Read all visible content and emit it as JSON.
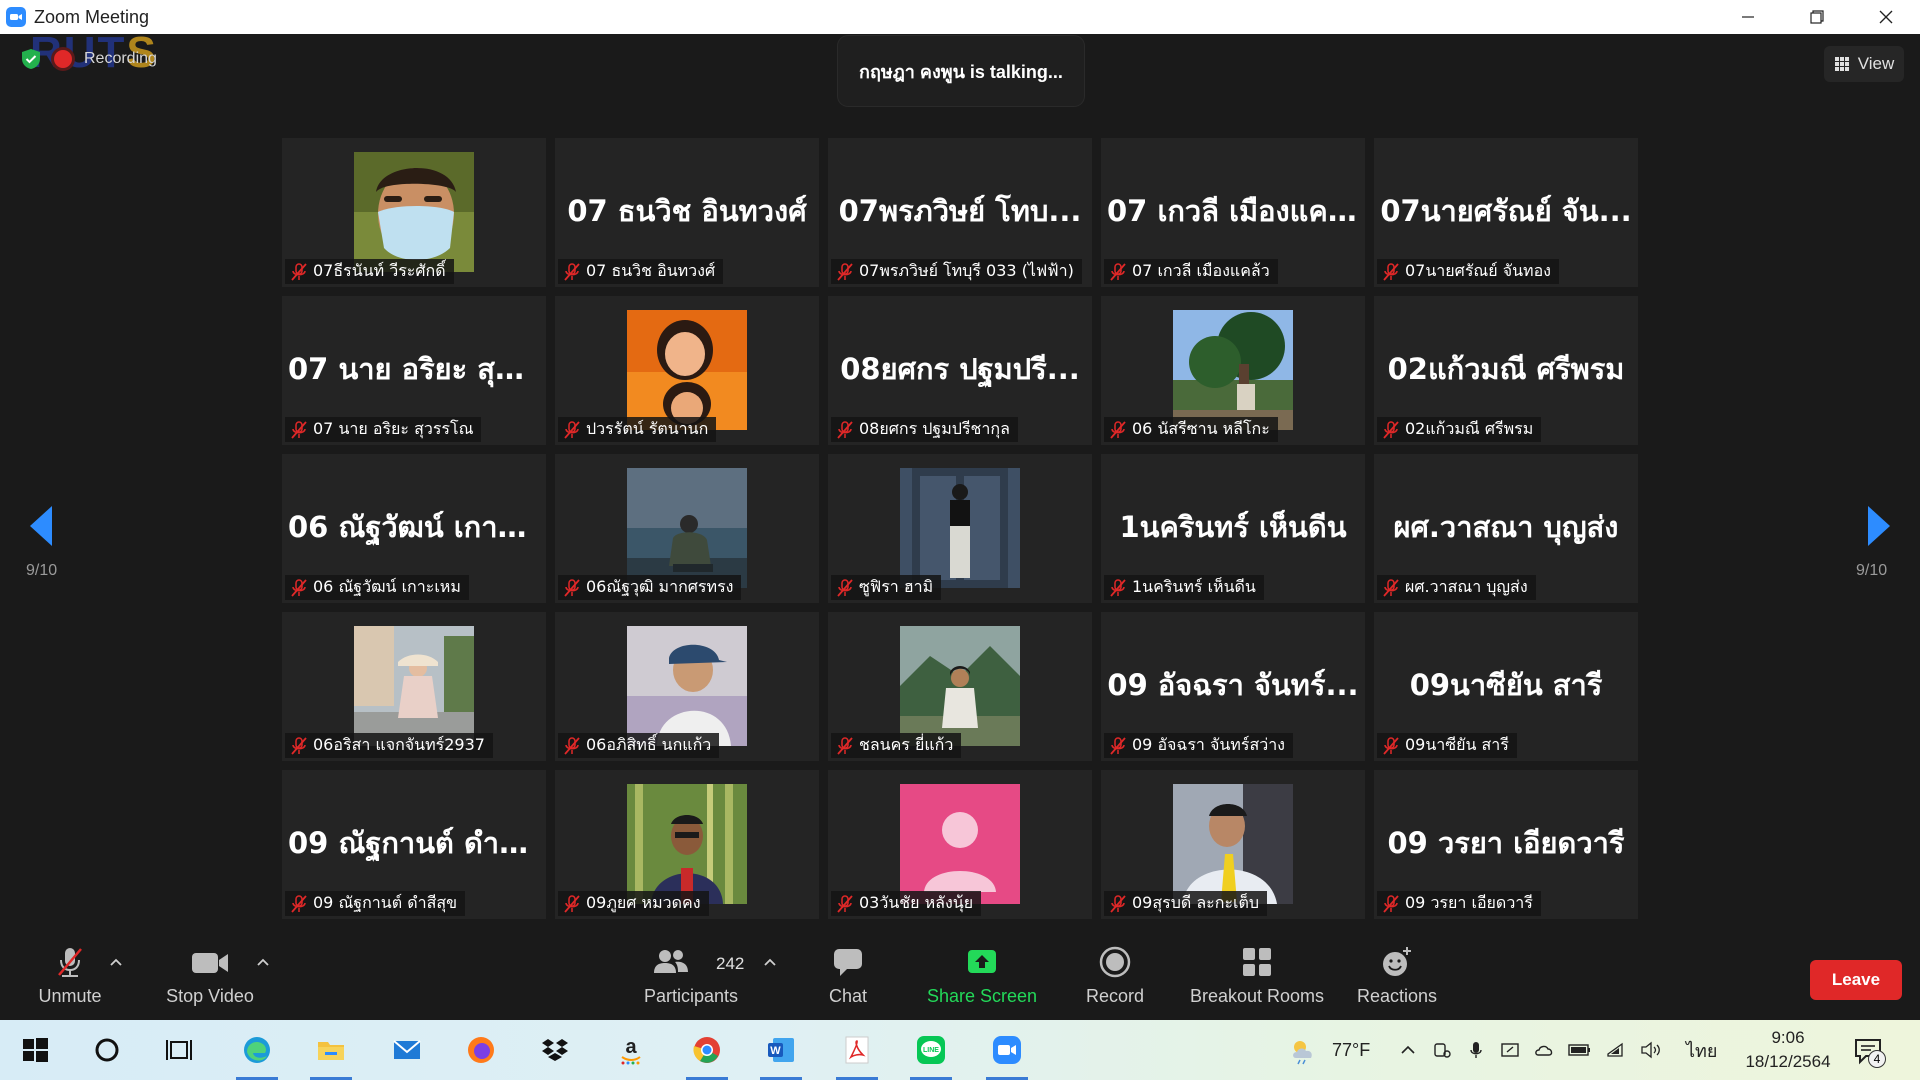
{
  "window": {
    "title": "Zoom Meeting"
  },
  "meeting": {
    "recording_label": "Recording",
    "talking_banner": "กฤษฎา คงพูน is talking...",
    "view_label": "View",
    "page_left": "9/10",
    "page_right": "9/10"
  },
  "tiles": [
    {
      "display": "",
      "label": "07ธีรนันท์ วีระศักดิ์",
      "has_photo": true,
      "photo": "mask-selfie"
    },
    {
      "display": "07 ธนวิช อินทวงศ์",
      "label": "07 ธนวิช อินทวงศ์",
      "has_photo": false
    },
    {
      "display": "07พรภวิษย์ โทบ...",
      "label": "07พรภวิษย์ โทบุรี 033 (ไฟฟ้า)",
      "has_photo": false
    },
    {
      "display": "07 เกวลี เมืองแคล้ว",
      "label": "07 เกวลี เมืองแคล้ว",
      "has_photo": false
    },
    {
      "display": "07นายศรัณย์ จัน...",
      "label": "07นายศรัณย์ จันทอง",
      "has_photo": false
    },
    {
      "display": "07 นาย อริยะ สุว...",
      "label": "07 นาย อริยะ สุวรรโณ",
      "has_photo": false
    },
    {
      "display": "",
      "label": "ปวรรัตน์ รัตนานก",
      "has_photo": true,
      "photo": "orange-portrait"
    },
    {
      "display": "08ยศกร ปฐมปรี...",
      "label": "08ยศกร ปฐมปรีชากุล",
      "has_photo": false
    },
    {
      "display": "",
      "label": "06 นัสรีซาน หลีโกะ",
      "has_photo": true,
      "photo": "tree-sky"
    },
    {
      "display": "02แก้วมณี ศรีพรม",
      "label": "02แก้วมณี ศรีพรม",
      "has_photo": false
    },
    {
      "display": "06 ณัฐวัฒน์ เกาะ...",
      "label": "06 ณัฐวัฒน์ เกาะเหม",
      "has_photo": false
    },
    {
      "display": "",
      "label": "06ณัฐวุฒิ มากศรทรง",
      "has_photo": true,
      "photo": "sea-crouch"
    },
    {
      "display": "",
      "label": "ซูฟิรา ฮามิ",
      "has_photo": true,
      "photo": "door-standing"
    },
    {
      "display": "1นครินทร์ เห็นดีน",
      "label": "1นครินทร์ เห็นดีน",
      "has_photo": false
    },
    {
      "display": "ผศ.วาสณา บุญส่ง",
      "label": "ผศ.วาสณา บุญส่ง",
      "has_photo": false
    },
    {
      "display": "",
      "label": "06อริสา แจกจันทร์2937",
      "has_photo": true,
      "photo": "street-girl"
    },
    {
      "display": "",
      "label": "06อภิสิทธิ์ นกแก้ว",
      "has_photo": true,
      "photo": "cap-boy"
    },
    {
      "display": "",
      "label": "ชลนคร ยี่แก้ว",
      "has_photo": true,
      "photo": "mountain-man"
    },
    {
      "display": "09 อัจฉรา จันทร์...",
      "label": "09 อัจฉรา จันทร์สว่าง",
      "has_photo": false
    },
    {
      "display": "09นาซียัน สารี",
      "label": "09นาซียัน สารี",
      "has_photo": false
    },
    {
      "display": "09 ณัฐกานต์ ดำสี...",
      "label": "09 ณัฐกานต์ ดำสีสุข",
      "has_photo": false
    },
    {
      "display": "",
      "label": "09ภูยศ หมวดคง",
      "has_photo": true,
      "photo": "bamboo-man"
    },
    {
      "display": "",
      "label": "03วันชัย หลังนุ้ย",
      "has_photo": true,
      "photo": "default-avatar"
    },
    {
      "display": "",
      "label": "09สุรบดี ละกะเต็บ",
      "has_photo": true,
      "photo": "shirt-tie"
    },
    {
      "display": "09 วรยา เอียดวารี",
      "label": "09 วรยา เอียดวารี",
      "has_photo": false
    }
  ],
  "toolbar": {
    "unmute": "Unmute",
    "stop_video": "Stop Video",
    "participants": "Participants",
    "participants_count": "242",
    "chat": "Chat",
    "share_screen": "Share Screen",
    "record": "Record",
    "breakout_rooms": "Breakout Rooms",
    "reactions": "Reactions",
    "leave": "Leave"
  },
  "taskbar": {
    "weather": "77°F",
    "language": "ไทย",
    "time": "9:06",
    "date": "18/12/2564",
    "notifications": "4",
    "apps": [
      "windows-start-icon",
      "search-circle-icon",
      "task-view-icon",
      "edge-icon",
      "file-explorer-icon",
      "mail-icon",
      "firefox-icon",
      "dropbox-icon",
      "amazon-icon",
      "chrome-icon",
      "word-icon",
      "acrobat-icon",
      "line-icon",
      "zoom-icon"
    ]
  },
  "colors": {
    "accent_blue": "#2d8cff",
    "share_green": "#23d959",
    "leave_red": "#e02828",
    "mute_red": "#e02828",
    "meeting_bg": "#1a1a1a",
    "tile_bg": "#242424"
  }
}
